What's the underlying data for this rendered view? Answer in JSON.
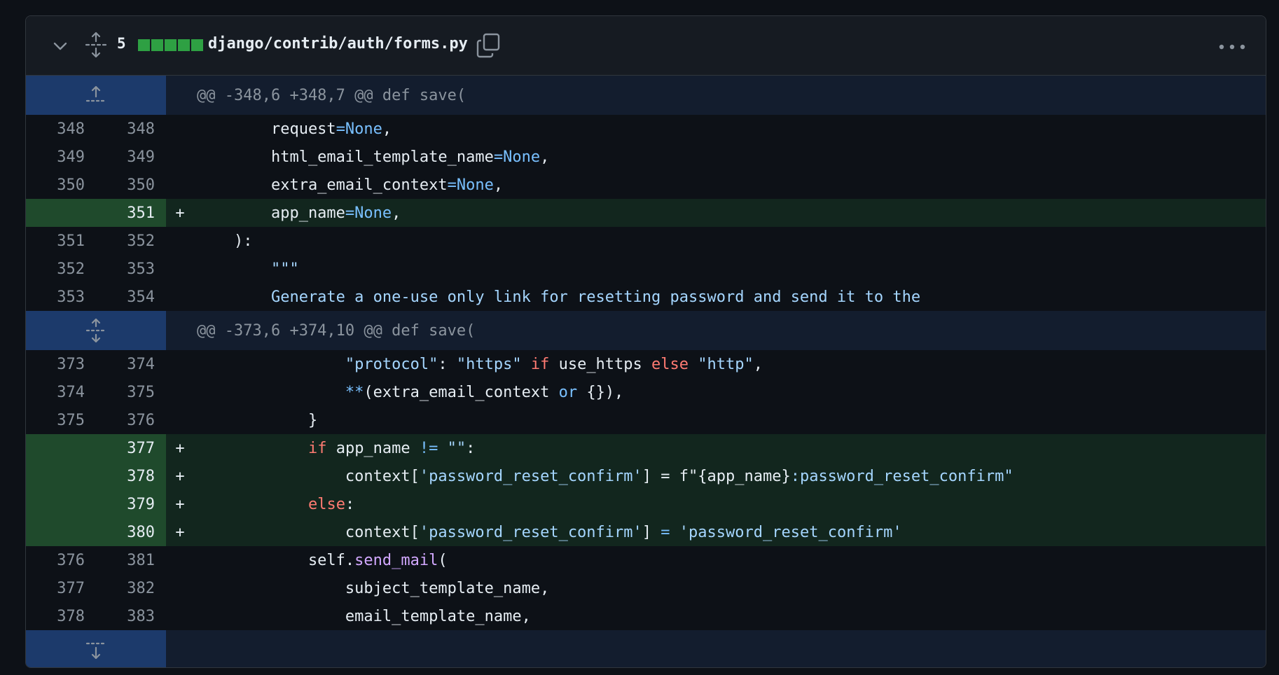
{
  "file": {
    "changes": "5",
    "path": "django/contrib/auth/forms.py",
    "bar_count": 5,
    "icons": [
      "chevron-down-icon",
      "unfold-icon",
      "copy-icon",
      "kebab-horizontal-icon"
    ]
  },
  "colors": {
    "addition_bar": "#2ea043",
    "hunk_bg": "#131d2e",
    "expander_bg": "#1c3a6b",
    "added_line_bg": "#12261e",
    "added_gutter_bg": "#1f4a2c"
  },
  "hunks": [
    {
      "header": "@@ -348,6 +348,7 @@ def save(",
      "expander_icon": "fold-up-icon"
    },
    {
      "header": "@@ -373,6 +374,10 @@ def save(",
      "expander_icon": "unfold-icon"
    },
    {
      "header": "",
      "expander_icon": "fold-down-icon"
    }
  ],
  "lines": [
    {
      "old": "348",
      "new": "348",
      "mark": "",
      "type": "ctx"
    },
    {
      "old": "349",
      "new": "349",
      "mark": "",
      "type": "ctx"
    },
    {
      "old": "350",
      "new": "350",
      "mark": "",
      "type": "ctx"
    },
    {
      "old": "",
      "new": "351",
      "mark": "+",
      "type": "add"
    },
    {
      "old": "351",
      "new": "352",
      "mark": "",
      "type": "ctx"
    },
    {
      "old": "352",
      "new": "353",
      "mark": "",
      "type": "ctx"
    },
    {
      "old": "353",
      "new": "354",
      "mark": "",
      "type": "ctx"
    },
    {
      "old": "373",
      "new": "374",
      "mark": "",
      "type": "ctx"
    },
    {
      "old": "374",
      "new": "375",
      "mark": "",
      "type": "ctx"
    },
    {
      "old": "375",
      "new": "376",
      "mark": "",
      "type": "ctx"
    },
    {
      "old": "",
      "new": "377",
      "mark": "+",
      "type": "add"
    },
    {
      "old": "",
      "new": "378",
      "mark": "+",
      "type": "add"
    },
    {
      "old": "",
      "new": "379",
      "mark": "+",
      "type": "add"
    },
    {
      "old": "",
      "new": "380",
      "mark": "+",
      "type": "add"
    },
    {
      "old": "376",
      "new": "381",
      "mark": "",
      "type": "ctx"
    },
    {
      "old": "377",
      "new": "382",
      "mark": "",
      "type": "ctx"
    },
    {
      "old": "378",
      "new": "383",
      "mark": "",
      "type": "ctx"
    }
  ],
  "code_tokens": {
    "l0": [
      "        request",
      "=None",
      ","
    ],
    "l1": [
      "        html_email_template_name",
      "=None",
      ","
    ],
    "l2": [
      "        extra_email_context",
      "=None",
      ","
    ],
    "l3": [
      "        app_name",
      "=None",
      ","
    ],
    "l4": [
      "    ):"
    ],
    "l5": [
      "        \"\"\""
    ],
    "l6": [
      "        Generate a one-use only link for resetting password and send it to the"
    ],
    "l7": [
      "                ",
      "\"protocol\"",
      ": ",
      "\"https\"",
      " if ",
      "use_https ",
      "else",
      " ",
      "\"http\"",
      ","
    ],
    "l8": [
      "                ",
      "**",
      "(extra_email_context ",
      "or",
      " {}),"
    ],
    "l9": [
      "            }"
    ],
    "l10": [
      "            ",
      "if",
      " app_name ",
      "!=",
      " ",
      "\"\"",
      ":"
    ],
    "l11": [
      "                context[",
      "'password_reset_confirm'",
      "] = f\"{app_name}",
      ":password_reset_confirm\""
    ],
    "l12": [
      "            ",
      "else",
      ":"
    ],
    "l13": [
      "                context[",
      "'password_reset_confirm'",
      "] ",
      "=",
      " ",
      "'password_reset_confirm'"
    ],
    "l14": [
      "            self.",
      "send_mail",
      "("
    ],
    "l15": [
      "                subject_template_name,"
    ],
    "l16": [
      "                email_template_name,"
    ]
  }
}
